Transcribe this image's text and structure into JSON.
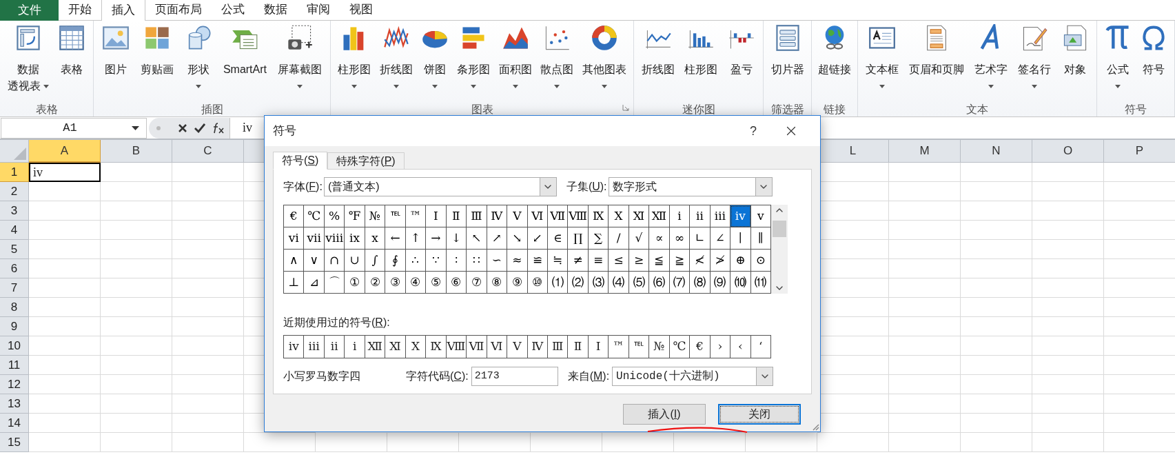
{
  "ribbon_tabs": [
    {
      "label": "文件",
      "kind": "file",
      "selected": false
    },
    {
      "label": "开始",
      "kind": "tab",
      "selected": false
    },
    {
      "label": "插入",
      "kind": "tab",
      "selected": true
    },
    {
      "label": "页面布局",
      "kind": "tab",
      "selected": false
    },
    {
      "label": "公式",
      "kind": "tab",
      "selected": false
    },
    {
      "label": "数据",
      "kind": "tab",
      "selected": false
    },
    {
      "label": "审阅",
      "kind": "tab",
      "selected": false
    },
    {
      "label": "视图",
      "kind": "tab",
      "selected": false
    }
  ],
  "ribbon_groups": [
    {
      "title": "表格",
      "launcher": false,
      "items": [
        {
          "label_lines": [
            "数据",
            "透视表"
          ],
          "dropdown": true
        },
        {
          "label_lines": [
            "表格"
          ],
          "dropdown": false
        }
      ]
    },
    {
      "title": "插图",
      "launcher": false,
      "items": [
        {
          "label_lines": [
            "图片"
          ],
          "dropdown": false
        },
        {
          "label_lines": [
            "剪贴画"
          ],
          "dropdown": false
        },
        {
          "label_lines": [
            "形状"
          ],
          "dropdown": true
        },
        {
          "label_lines": [
            "SmartArt"
          ],
          "dropdown": false
        },
        {
          "label_lines": [
            "屏幕截图"
          ],
          "dropdown": true
        }
      ]
    },
    {
      "title": "图表",
      "launcher": true,
      "items": [
        {
          "label_lines": [
            "柱形图"
          ],
          "dropdown": true
        },
        {
          "label_lines": [
            "折线图"
          ],
          "dropdown": true
        },
        {
          "label_lines": [
            "饼图"
          ],
          "dropdown": true
        },
        {
          "label_lines": [
            "条形图"
          ],
          "dropdown": true
        },
        {
          "label_lines": [
            "面积图"
          ],
          "dropdown": true
        },
        {
          "label_lines": [
            "散点图"
          ],
          "dropdown": true
        },
        {
          "label_lines": [
            "其他图表"
          ],
          "dropdown": true
        }
      ]
    },
    {
      "title": "迷你图",
      "launcher": false,
      "items": [
        {
          "label_lines": [
            "折线图"
          ],
          "dropdown": false
        },
        {
          "label_lines": [
            "柱形图"
          ],
          "dropdown": false
        },
        {
          "label_lines": [
            "盈亏"
          ],
          "dropdown": false
        }
      ]
    },
    {
      "title": "筛选器",
      "launcher": false,
      "items": [
        {
          "label_lines": [
            "切片器"
          ],
          "dropdown": false
        }
      ]
    },
    {
      "title": "链接",
      "launcher": false,
      "items": [
        {
          "label_lines": [
            "超链接"
          ],
          "dropdown": false
        }
      ]
    },
    {
      "title": "文本",
      "launcher": false,
      "items": [
        {
          "label_lines": [
            "文本框"
          ],
          "dropdown": true
        },
        {
          "label_lines": [
            "页眉和页脚"
          ],
          "dropdown": false
        },
        {
          "label_lines": [
            "艺术字"
          ],
          "dropdown": true
        },
        {
          "label_lines": [
            "签名行"
          ],
          "dropdown": true
        },
        {
          "label_lines": [
            "对象"
          ],
          "dropdown": false
        }
      ]
    },
    {
      "title": "符号",
      "launcher": false,
      "items": [
        {
          "label_lines": [
            "公式"
          ],
          "dropdown": true
        },
        {
          "label_lines": [
            "符号"
          ],
          "dropdown": false
        }
      ]
    }
  ],
  "name_box": "A1",
  "formula": "iv",
  "sheet": {
    "columns_left": [
      {
        "label": "A",
        "selected": true
      },
      {
        "label": "B",
        "selected": false
      },
      {
        "label": "C",
        "selected": false
      }
    ],
    "columns_right": [
      {
        "label": "L",
        "selected": false
      },
      {
        "label": "M",
        "selected": false
      },
      {
        "label": "N",
        "selected": false
      },
      {
        "label": "O",
        "selected": false
      },
      {
        "label": "P",
        "selected": false
      }
    ],
    "rows": [
      {
        "label": "1",
        "selected": true,
        "cells": [
          "iv"
        ]
      },
      {
        "label": "2",
        "selected": false
      },
      {
        "label": "3",
        "selected": false
      },
      {
        "label": "4",
        "selected": false
      },
      {
        "label": "5",
        "selected": false
      },
      {
        "label": "6",
        "selected": false
      },
      {
        "label": "7",
        "selected": false
      },
      {
        "label": "8",
        "selected": false
      },
      {
        "label": "9",
        "selected": false
      },
      {
        "label": "10",
        "selected": false
      },
      {
        "label": "11",
        "selected": false
      },
      {
        "label": "12",
        "selected": false
      },
      {
        "label": "13",
        "selected": false
      },
      {
        "label": "14",
        "selected": false
      },
      {
        "label": "15",
        "selected": false
      }
    ]
  },
  "dialog": {
    "title": "符号",
    "help": "?",
    "tabs": [
      {
        "label": [
          {
            "t": "符号("
          },
          {
            "t": "S",
            "u": true
          },
          {
            "t": ")"
          }
        ],
        "selected": true
      },
      {
        "label": [
          {
            "t": "特殊字符("
          },
          {
            "t": "P",
            "u": true
          },
          {
            "t": ")"
          }
        ],
        "selected": false
      }
    ],
    "font_label": [
      {
        "t": "字体("
      },
      {
        "t": "F",
        "u": true
      },
      {
        "t": "):"
      }
    ],
    "font_value": "(普通文本)",
    "subset_label": [
      {
        "t": "子集("
      },
      {
        "t": "U",
        "u": true
      },
      {
        "t": "):"
      }
    ],
    "subset_value": "数字形式",
    "symbol_rows": [
      [
        {
          "c": "€",
          "selected": false
        },
        {
          "c": "℃",
          "selected": false
        },
        {
          "c": "%",
          "selected": false
        },
        {
          "c": "℉",
          "selected": false
        },
        {
          "c": "№",
          "selected": false
        },
        {
          "c": "℡",
          "selected": false
        },
        {
          "c": "™",
          "selected": false
        },
        {
          "c": "Ⅰ",
          "selected": false
        },
        {
          "c": "Ⅱ",
          "selected": false
        },
        {
          "c": "Ⅲ",
          "selected": false
        },
        {
          "c": "Ⅳ",
          "selected": false
        },
        {
          "c": "Ⅴ",
          "selected": false
        },
        {
          "c": "Ⅵ",
          "selected": false
        },
        {
          "c": "Ⅶ",
          "selected": false
        },
        {
          "c": "Ⅷ",
          "selected": false
        },
        {
          "c": "Ⅸ",
          "selected": false
        },
        {
          "c": "Ⅹ",
          "selected": false
        },
        {
          "c": "Ⅺ",
          "selected": false
        },
        {
          "c": "Ⅻ",
          "selected": false
        },
        {
          "c": "ⅰ",
          "selected": false
        },
        {
          "c": "ⅱ",
          "selected": false
        },
        {
          "c": "ⅲ",
          "selected": false
        },
        {
          "c": "ⅳ",
          "selected": true
        },
        {
          "c": "ⅴ",
          "selected": false
        }
      ],
      [
        {
          "c": "ⅵ",
          "selected": false
        },
        {
          "c": "ⅶ",
          "selected": false
        },
        {
          "c": "ⅷ",
          "selected": false
        },
        {
          "c": "ⅸ",
          "selected": false
        },
        {
          "c": "ⅹ",
          "selected": false
        },
        {
          "c": "←",
          "selected": false
        },
        {
          "c": "↑",
          "selected": false
        },
        {
          "c": "→",
          "selected": false
        },
        {
          "c": "↓",
          "selected": false
        },
        {
          "c": "↖",
          "selected": false
        },
        {
          "c": "↗",
          "selected": false
        },
        {
          "c": "↘",
          "selected": false
        },
        {
          "c": "↙",
          "selected": false
        },
        {
          "c": "∈",
          "selected": false
        },
        {
          "c": "∏",
          "selected": false
        },
        {
          "c": "∑",
          "selected": false
        },
        {
          "c": "∕",
          "selected": false
        },
        {
          "c": "√",
          "selected": false
        },
        {
          "c": "∝",
          "selected": false
        },
        {
          "c": "∞",
          "selected": false
        },
        {
          "c": "∟",
          "selected": false
        },
        {
          "c": "∠",
          "selected": false
        },
        {
          "c": "∣",
          "selected": false
        },
        {
          "c": "∥",
          "selected": false
        }
      ],
      [
        {
          "c": "∧",
          "selected": false
        },
        {
          "c": "∨",
          "selected": false
        },
        {
          "c": "∩",
          "selected": false
        },
        {
          "c": "∪",
          "selected": false
        },
        {
          "c": "∫",
          "selected": false
        },
        {
          "c": "∮",
          "selected": false
        },
        {
          "c": "∴",
          "selected": false
        },
        {
          "c": "∵",
          "selected": false
        },
        {
          "c": "∶",
          "selected": false
        },
        {
          "c": "∷",
          "selected": false
        },
        {
          "c": "∽",
          "selected": false
        },
        {
          "c": "≈",
          "selected": false
        },
        {
          "c": "≌",
          "selected": false
        },
        {
          "c": "≒",
          "selected": false
        },
        {
          "c": "≠",
          "selected": false
        },
        {
          "c": "≡",
          "selected": false
        },
        {
          "c": "≤",
          "selected": false
        },
        {
          "c": "≥",
          "selected": false
        },
        {
          "c": "≦",
          "selected": false
        },
        {
          "c": "≧",
          "selected": false
        },
        {
          "c": "≮",
          "selected": false
        },
        {
          "c": "≯",
          "selected": false
        },
        {
          "c": "⊕",
          "selected": false
        },
        {
          "c": "⊙",
          "selected": false
        }
      ],
      [
        {
          "c": "⊥",
          "selected": false
        },
        {
          "c": "⊿",
          "selected": false
        },
        {
          "c": "⌒",
          "selected": false
        },
        {
          "c": "①",
          "selected": false
        },
        {
          "c": "②",
          "selected": false
        },
        {
          "c": "③",
          "selected": false
        },
        {
          "c": "④",
          "selected": false
        },
        {
          "c": "⑤",
          "selected": false
        },
        {
          "c": "⑥",
          "selected": false
        },
        {
          "c": "⑦",
          "selected": false
        },
        {
          "c": "⑧",
          "selected": false
        },
        {
          "c": "⑨",
          "selected": false
        },
        {
          "c": "⑩",
          "selected": false
        },
        {
          "c": "⑴",
          "selected": false
        },
        {
          "c": "⑵",
          "selected": false
        },
        {
          "c": "⑶",
          "selected": false
        },
        {
          "c": "⑷",
          "selected": false
        },
        {
          "c": "⑸",
          "selected": false
        },
        {
          "c": "⑹",
          "selected": false
        },
        {
          "c": "⑺",
          "selected": false
        },
        {
          "c": "⑻",
          "selected": false
        },
        {
          "c": "⑼",
          "selected": false
        },
        {
          "c": "⑽",
          "selected": false
        },
        {
          "c": "⑾",
          "selected": false
        }
      ]
    ],
    "recent_label": [
      {
        "t": "近期使用过的符号("
      },
      {
        "t": "R",
        "u": true
      },
      {
        "t": "):"
      }
    ],
    "recent": [
      "ⅳ",
      "ⅲ",
      "ⅱ",
      "ⅰ",
      "Ⅻ",
      "Ⅺ",
      "Ⅹ",
      "Ⅸ",
      "Ⅷ",
      "Ⅶ",
      "Ⅵ",
      "Ⅴ",
      "Ⅳ",
      "Ⅲ",
      "Ⅱ",
      "Ⅰ",
      "™",
      "℡",
      "№",
      "℃",
      "€",
      "›",
      "‹",
      "‘"
    ],
    "description": "小写罗马数字四",
    "code_label": [
      {
        "t": "字符代码("
      },
      {
        "t": "C",
        "u": true
      },
      {
        "t": "):"
      }
    ],
    "code_value": "2173",
    "from_label": [
      {
        "t": "来自("
      },
      {
        "t": "M",
        "u": true
      },
      {
        "t": "):"
      }
    ],
    "from_value": "Unicode(十六进制)",
    "buttons": [
      {
        "label": [
          {
            "t": "插入("
          },
          {
            "t": "I",
            "u": true
          },
          {
            "t": ")"
          }
        ],
        "default": false
      },
      {
        "label": [
          {
            "t": "关闭"
          }
        ],
        "default": true
      }
    ]
  }
}
